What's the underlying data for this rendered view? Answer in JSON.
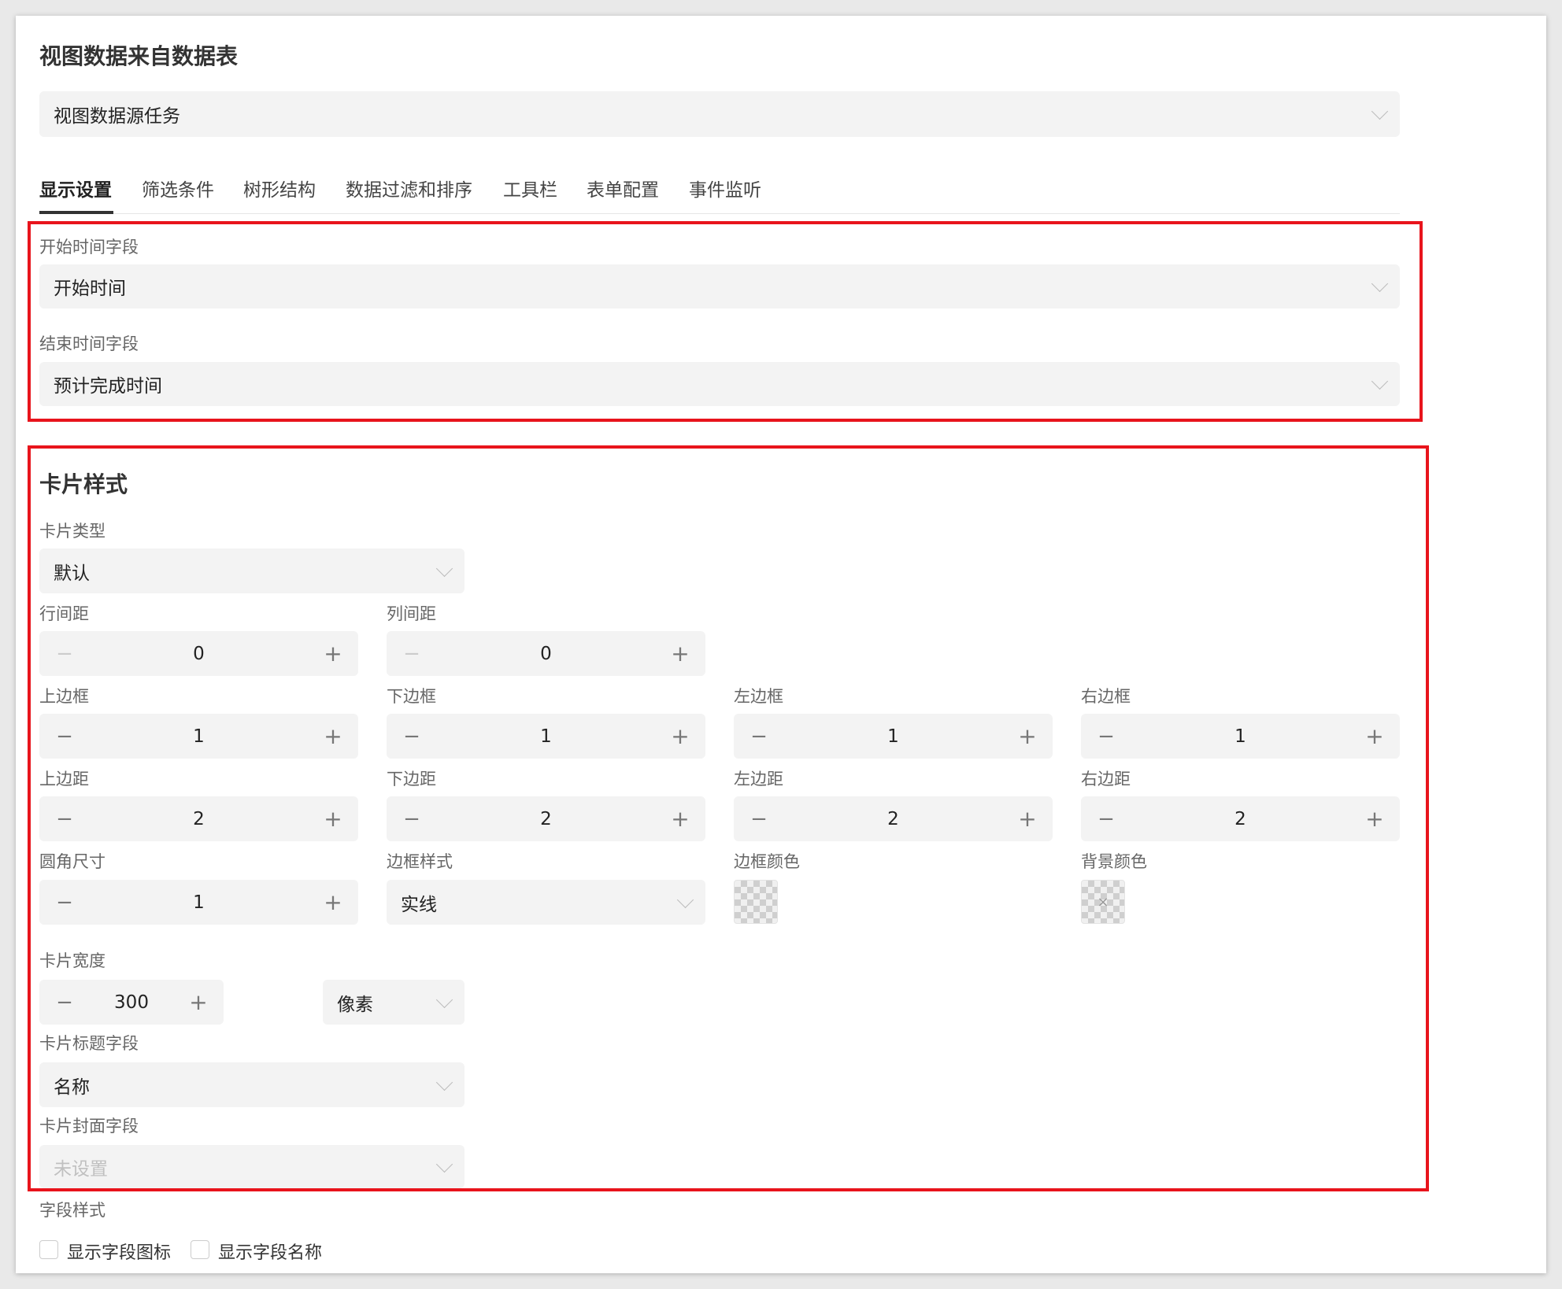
{
  "header": {
    "title": "视图数据来自数据表",
    "source_select": "视图数据源任务"
  },
  "tabs": [
    "显示设置",
    "筛选条件",
    "树形结构",
    "数据过滤和排序",
    "工具栏",
    "表单配置",
    "事件监听"
  ],
  "time_fields": {
    "start_label": "开始时间字段",
    "start_value": "开始时间",
    "end_label": "结束时间字段",
    "end_value": "预计完成时间"
  },
  "card_style": {
    "title": "卡片样式",
    "type_label": "卡片类型",
    "type_value": "默认",
    "row_gap": {
      "label": "行间距",
      "value": "0"
    },
    "col_gap": {
      "label": "列间距",
      "value": "0"
    },
    "border_top": {
      "label": "上边框",
      "value": "1"
    },
    "border_bottom": {
      "label": "下边框",
      "value": "1"
    },
    "border_left": {
      "label": "左边框",
      "value": "1"
    },
    "border_right": {
      "label": "右边框",
      "value": "1"
    },
    "margin_top": {
      "label": "上边距",
      "value": "2"
    },
    "margin_bottom": {
      "label": "下边距",
      "value": "2"
    },
    "margin_left": {
      "label": "左边距",
      "value": "2"
    },
    "margin_right": {
      "label": "右边距",
      "value": "2"
    },
    "radius": {
      "label": "圆角尺寸",
      "value": "1"
    },
    "border_style": {
      "label": "边框样式",
      "value": "实线"
    },
    "border_color_label": "边框颜色",
    "bg_color_label": "背景颜色",
    "width": {
      "label": "卡片宽度",
      "value": "300",
      "unit": "像素"
    },
    "title_field": {
      "label": "卡片标题字段",
      "value": "名称"
    },
    "cover_field": {
      "label": "卡片封面字段",
      "placeholder": "未设置"
    }
  },
  "field_style": {
    "label": "字段样式",
    "show_icon": "显示字段图标",
    "show_name": "显示字段名称"
  },
  "icons": {
    "minus": "−",
    "plus": "+"
  },
  "colors": {
    "highlight_border": "#e8141c"
  }
}
